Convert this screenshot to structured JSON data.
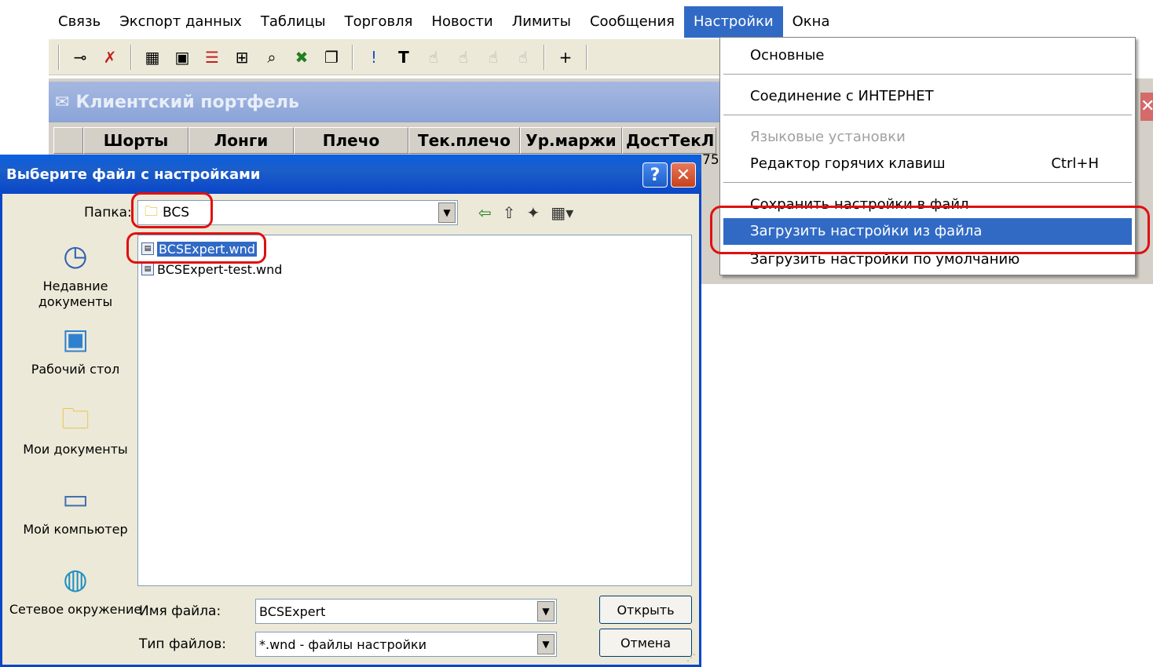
{
  "menubar": {
    "items": [
      "Связь",
      "Экспорт данных",
      "Таблицы",
      "Торговля",
      "Новости",
      "Лимиты",
      "Сообщения",
      "Настройки",
      "Окна"
    ],
    "active_index": 7
  },
  "portfolio": {
    "title": "Клиентский портфель",
    "columns": [
      "Шорты",
      "Лонги",
      "Плечо",
      "Тек.плечо",
      "Ур.маржи",
      "ДостТекЛ"
    ],
    "cell_peek": "75"
  },
  "settings_menu": {
    "basic": "Основные",
    "internet": "Соединение с ИНТЕРНЕТ",
    "language": "Языковые установки",
    "hotkeys": "Редактор горячих клавиш",
    "hotkeys_shortcut": "Ctrl+H",
    "save": "Сохранить настройки в файл",
    "load": "Загрузить настройки из файла",
    "load_default": "Загрузить настройки по умолчанию"
  },
  "dialog": {
    "title": "Выберите файл с настройками",
    "help_label": "?",
    "close_label": "✕",
    "folder_label": "Папка:",
    "folder_value": "BCS",
    "places": [
      "Недавние документы",
      "Рабочий стол",
      "Мои документы",
      "Мой компьютер",
      "Сетевое окружение"
    ],
    "files": [
      "BCSExpert.wnd",
      "BCSExpert-test.wnd"
    ],
    "selected_file_index": 0,
    "filename_label": "Имя файла:",
    "filename_value": "BCSExpert",
    "filetype_label": "Тип файлов:",
    "filetype_value": "*.wnd - файлы настройки",
    "open_button": "Открыть",
    "cancel_button": "Отмена"
  },
  "colors": {
    "selection": "#316ac5",
    "highlight_ring": "#e01010",
    "title_bar": "#0a46c8"
  }
}
